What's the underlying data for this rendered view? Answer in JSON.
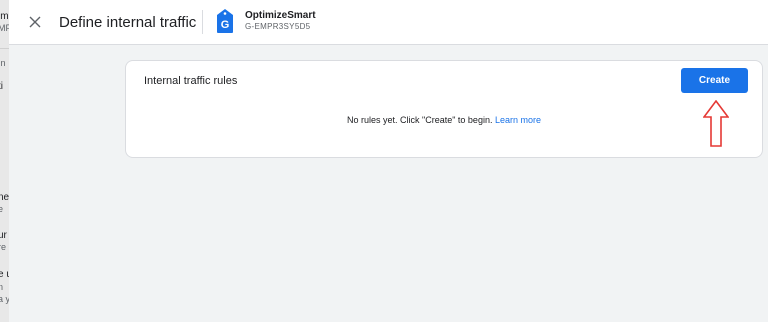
{
  "background_panel": {
    "fragments": [
      "im",
      "MP",
      "In",
      "ti",
      "ne",
      "e",
      "ur",
      "re",
      "e u",
      "n",
      "a yo"
    ]
  },
  "header": {
    "close_icon": "close-icon",
    "title": "Define internal traffic",
    "property": {
      "icon": "google-analytics-tag-icon",
      "icon_letter": "G",
      "name": "OptimizeSmart",
      "id": "G-EMPR3SY5D5"
    }
  },
  "card": {
    "title": "Internal traffic rules",
    "create_label": "Create",
    "empty_message": "No rules yet. Click \"Create\" to begin.",
    "learn_more_label": "Learn more"
  },
  "annotation": {
    "icon": "red-up-arrow",
    "color": "#e53935"
  },
  "colors": {
    "accent": "#1a73e8",
    "background": "#f1f3f4",
    "card": "#ffffff"
  }
}
